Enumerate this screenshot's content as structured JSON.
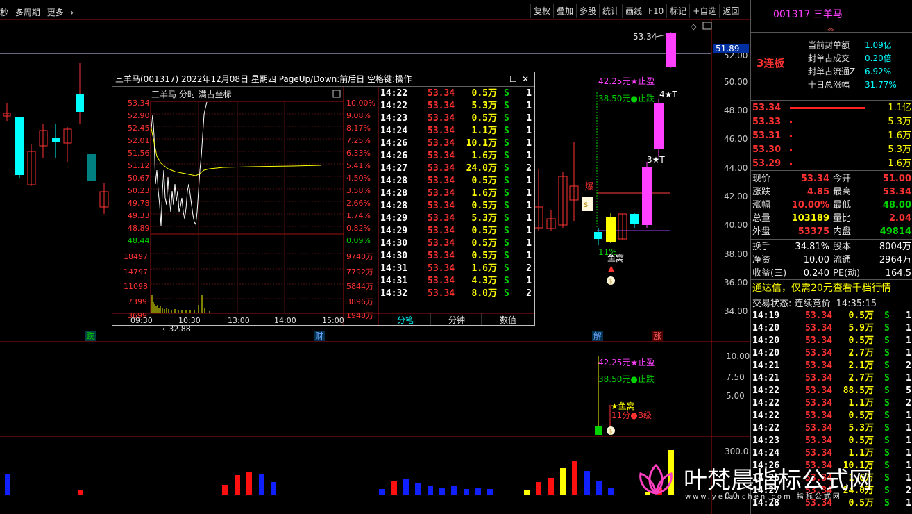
{
  "toolbar": {
    "left_items": [
      "秒",
      "多周期",
      "更多"
    ],
    "right_buttons": [
      "复权",
      "叠加",
      "多股",
      "统计",
      "画线",
      "F10",
      "标记",
      "+自选",
      "返回"
    ]
  },
  "stock": {
    "code": "001317",
    "name": "三羊马"
  },
  "main_chart": {
    "price_axis": [
      "52.00",
      "50.00",
      "48.00",
      "46.00",
      "44.00",
      "42.00",
      "40.00",
      "38.00",
      "36.00",
      "34.00"
    ],
    "current_line_label": "51.89",
    "high_label": "53.34",
    "low_label": "←32.88",
    "event_markers": [
      "跌",
      "财",
      "解",
      "涨"
    ],
    "annotations": {
      "take_profit": "42.25元★止盈",
      "stop_loss": "38.50元●止跌",
      "label_4t": "4★T",
      "label_3t": "3★T",
      "label_bao": "爆",
      "label_11": "11%",
      "label_yuwo": "鱼窝"
    }
  },
  "sub_chart1": {
    "axis": [
      "10.00",
      "7.50",
      "5.00"
    ],
    "take_profit": "42.25元★止盈",
    "stop_loss": "38.50元●止跌",
    "yuwo": "★鱼窝",
    "grade": "11分●B级"
  },
  "sub_chart2": {
    "axis": [
      "300.0",
      "0.0"
    ]
  },
  "popup": {
    "title": "三羊马(001317) 2022年12月08日 星期四 PageUp/Down:前后日 空格键:操作",
    "chart_header": "三羊马  分时  满占坐标",
    "price_labels": [
      "53.34",
      "52.90",
      "52.45",
      "52.01",
      "51.56",
      "51.12",
      "50.67",
      "50.23",
      "49.78",
      "49.33",
      "48.89",
      "48.44"
    ],
    "pct_labels": [
      "10.00%",
      "9.08%",
      "8.17%",
      "7.25%",
      "6.33%",
      "5.41%",
      "4.50%",
      "3.58%",
      "2.66%",
      "1.74%",
      "0.82%",
      "0.09%"
    ],
    "vol_labels_left": [
      "18497",
      "14797",
      "11098",
      "7399",
      "3699"
    ],
    "vol_labels_right": [
      "9740万",
      "7792万",
      "5844万",
      "3896万",
      "1948万"
    ],
    "time_labels": [
      "09:30",
      "10:30",
      "13:00",
      "14:00",
      "15:00"
    ],
    "ticks": [
      {
        "t": "14:22",
        "p": "53.34",
        "v": "0.5万",
        "s": "S",
        "n": "1"
      },
      {
        "t": "14:22",
        "p": "53.34",
        "v": "5.3万",
        "s": "S",
        "n": "1"
      },
      {
        "t": "14:23",
        "p": "53.34",
        "v": "0.5万",
        "s": "S",
        "n": "1"
      },
      {
        "t": "14:24",
        "p": "53.34",
        "v": "1.1万",
        "s": "S",
        "n": "1"
      },
      {
        "t": "14:26",
        "p": "53.34",
        "v": "10.1万",
        "s": "S",
        "n": "1"
      },
      {
        "t": "14:26",
        "p": "53.34",
        "v": "1.6万",
        "s": "S",
        "n": "1"
      },
      {
        "t": "14:27",
        "p": "53.34",
        "v": "24.0万",
        "s": "S",
        "n": "2"
      },
      {
        "t": "14:28",
        "p": "53.34",
        "v": "0.5万",
        "s": "S",
        "n": "1"
      },
      {
        "t": "14:28",
        "p": "53.34",
        "v": "1.6万",
        "s": "S",
        "n": "1"
      },
      {
        "t": "14:28",
        "p": "53.34",
        "v": "0.5万",
        "s": "S",
        "n": "1"
      },
      {
        "t": "14:29",
        "p": "53.34",
        "v": "5.3万",
        "s": "S",
        "n": "1"
      },
      {
        "t": "14:29",
        "p": "53.34",
        "v": "0.5万",
        "s": "S",
        "n": "1"
      },
      {
        "t": "14:30",
        "p": "53.34",
        "v": "0.5万",
        "s": "S",
        "n": "1"
      },
      {
        "t": "14:30",
        "p": "53.34",
        "v": "0.5万",
        "s": "S",
        "n": "1"
      },
      {
        "t": "14:31",
        "p": "53.34",
        "v": "1.6万",
        "s": "S",
        "n": "2"
      },
      {
        "t": "14:31",
        "p": "53.34",
        "v": "4.3万",
        "s": "S",
        "n": "1"
      },
      {
        "t": "14:32",
        "p": "53.34",
        "v": "8.0万",
        "s": "S",
        "n": "2"
      }
    ],
    "tabs": [
      "分笔",
      "分钟",
      "数值"
    ]
  },
  "right_panel": {
    "board": "3连板",
    "seal_info": [
      {
        "k": "当前封单额",
        "v": "1.09亿"
      },
      {
        "k": "封单占成交",
        "v": "0.20倍"
      },
      {
        "k": "封单占流通Z",
        "v": "6.92%"
      },
      {
        "k": "十日总涨幅",
        "v": "31.77%"
      }
    ],
    "bids": [
      {
        "p": "53.34",
        "v": "1.1亿"
      },
      {
        "p": "53.33",
        "v": "5.3万"
      },
      {
        "p": "53.31",
        "v": "1.6万"
      },
      {
        "p": "53.30",
        "v": "5.3万"
      },
      {
        "p": "53.29",
        "v": "1.6万"
      }
    ],
    "quote": [
      {
        "k1": "现价",
        "v1": "53.34",
        "k2": "今开",
        "v2": "51.00"
      },
      {
        "k1": "涨跌",
        "v1": "4.85",
        "k2": "最高",
        "v2": "53.34"
      },
      {
        "k1": "涨幅",
        "v1": "10.00%",
        "k2": "最低",
        "v2": "48.00"
      },
      {
        "k1": "总量",
        "v1": "103189",
        "k2": "量比",
        "v2": "2.04"
      },
      {
        "k1": "外盘",
        "v1": "53375",
        "k2": "内盘",
        "v2": "49814"
      }
    ],
    "fundamentals": [
      {
        "k1": "换手",
        "v1": "34.81%",
        "k2": "股本",
        "v2": "8004万"
      },
      {
        "k1": "净资",
        "v1": "10.00",
        "k2": "流通",
        "v2": "2964万"
      },
      {
        "k1": "收益(三)",
        "v1": "0.240",
        "k2": "PE(动)",
        "v2": "164.5"
      }
    ],
    "promo": "通达信，仅需20元查看千档行情",
    "status_label": "交易状态: 连续竞价",
    "status_time": "14:35:15",
    "ticks": [
      {
        "t": "14:19",
        "p": "53.34",
        "v": "0.5万",
        "s": "S",
        "n": "1"
      },
      {
        "t": "14:20",
        "p": "53.34",
        "v": "5.9万",
        "s": "S",
        "n": "1"
      },
      {
        "t": "14:20",
        "p": "53.34",
        "v": "0.5万",
        "s": "S",
        "n": "1"
      },
      {
        "t": "14:20",
        "p": "53.34",
        "v": "2.7万",
        "s": "S",
        "n": "1"
      },
      {
        "t": "14:21",
        "p": "53.34",
        "v": "2.1万",
        "s": "S",
        "n": "2"
      },
      {
        "t": "14:21",
        "p": "53.34",
        "v": "2.7万",
        "s": "S",
        "n": "1"
      },
      {
        "t": "14:22",
        "p": "53.34",
        "v": "88.5万",
        "s": "S",
        "n": "5"
      },
      {
        "t": "14:22",
        "p": "53.34",
        "v": "1.1万",
        "s": "S",
        "n": "2"
      },
      {
        "t": "14:22",
        "p": "53.34",
        "v": "0.5万",
        "s": "S",
        "n": "1"
      },
      {
        "t": "14:22",
        "p": "53.34",
        "v": "5.3万",
        "s": "S",
        "n": "1"
      },
      {
        "t": "14:23",
        "p": "53.34",
        "v": "0.5万",
        "s": "S",
        "n": "1"
      },
      {
        "t": "14:24",
        "p": "53.34",
        "v": "1.1万",
        "s": "S",
        "n": "1"
      },
      {
        "t": "14:26",
        "p": "53.34",
        "v": "10.1万",
        "s": "S",
        "n": "1"
      },
      {
        "t": "14:26",
        "p": "53.34",
        "v": "1.6万",
        "s": "S",
        "n": "1"
      },
      {
        "t": "14:27",
        "p": "53.34",
        "v": "24.0万",
        "s": "S",
        "n": "2"
      },
      {
        "t": "14:28",
        "p": "53.34",
        "v": "0.5万",
        "s": "S",
        "n": "1"
      }
    ]
  },
  "watermark": {
    "title": "叶梵晨指标公式网",
    "url": "www.yefanchen.com 指标公式网"
  }
}
